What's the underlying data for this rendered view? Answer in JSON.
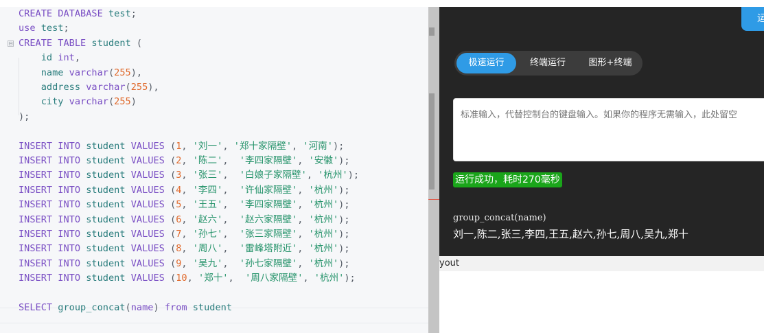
{
  "editor": {
    "fold_marker": "⊟",
    "lines": [
      [
        {
          "t": "CREATE DATABASE ",
          "c": "kw"
        },
        {
          "t": "test",
          "c": "id"
        },
        {
          "t": ";",
          "c": "pun"
        }
      ],
      [
        {
          "t": "use ",
          "c": "kw"
        },
        {
          "t": "test",
          "c": "id"
        },
        {
          "t": ";",
          "c": "pun"
        }
      ],
      [
        {
          "t": "CREATE TABLE ",
          "c": "kw"
        },
        {
          "t": "student ",
          "c": "id"
        },
        {
          "t": "(",
          "c": "pun"
        }
      ],
      [
        {
          "t": "    id ",
          "c": "id"
        },
        {
          "t": "int",
          "c": "kw"
        },
        {
          "t": ",",
          "c": "pun"
        }
      ],
      [
        {
          "t": "    name ",
          "c": "id"
        },
        {
          "t": "varchar",
          "c": "kw"
        },
        {
          "t": "(",
          "c": "pun"
        },
        {
          "t": "255",
          "c": "num"
        },
        {
          "t": "),",
          "c": "pun"
        }
      ],
      [
        {
          "t": "    address ",
          "c": "id"
        },
        {
          "t": "varchar",
          "c": "kw"
        },
        {
          "t": "(",
          "c": "pun"
        },
        {
          "t": "255",
          "c": "num"
        },
        {
          "t": "),",
          "c": "pun"
        }
      ],
      [
        {
          "t": "    city ",
          "c": "id"
        },
        {
          "t": "varchar",
          "c": "kw"
        },
        {
          "t": "(",
          "c": "pun"
        },
        {
          "t": "255",
          "c": "num"
        },
        {
          "t": ")",
          "c": "pun"
        }
      ],
      [
        {
          "t": ");",
          "c": "pun"
        }
      ],
      [],
      [
        {
          "t": "INSERT INTO ",
          "c": "kw"
        },
        {
          "t": "student ",
          "c": "id"
        },
        {
          "t": "VALUES ",
          "c": "kw"
        },
        {
          "t": "(",
          "c": "pun"
        },
        {
          "t": "1",
          "c": "num"
        },
        {
          "t": ", ",
          "c": "pun"
        },
        {
          "t": "'刘一'",
          "c": "str"
        },
        {
          "t": ", ",
          "c": "pun"
        },
        {
          "t": "'郑十家隔壁'",
          "c": "str"
        },
        {
          "t": ", ",
          "c": "pun"
        },
        {
          "t": "'河南'",
          "c": "str"
        },
        {
          "t": ");",
          "c": "pun"
        }
      ],
      [
        {
          "t": "INSERT INTO ",
          "c": "kw"
        },
        {
          "t": "student ",
          "c": "id"
        },
        {
          "t": "VALUES ",
          "c": "kw"
        },
        {
          "t": "(",
          "c": "pun"
        },
        {
          "t": "2",
          "c": "num"
        },
        {
          "t": ", ",
          "c": "pun"
        },
        {
          "t": "'陈二'",
          "c": "str"
        },
        {
          "t": ",  ",
          "c": "pun"
        },
        {
          "t": "'李四家隔壁'",
          "c": "str"
        },
        {
          "t": ", ",
          "c": "pun"
        },
        {
          "t": "'安徽'",
          "c": "str"
        },
        {
          "t": ");",
          "c": "pun"
        }
      ],
      [
        {
          "t": "INSERT INTO ",
          "c": "kw"
        },
        {
          "t": "student ",
          "c": "id"
        },
        {
          "t": "VALUES ",
          "c": "kw"
        },
        {
          "t": "(",
          "c": "pun"
        },
        {
          "t": "3",
          "c": "num"
        },
        {
          "t": ", ",
          "c": "pun"
        },
        {
          "t": "'张三'",
          "c": "str"
        },
        {
          "t": ",  ",
          "c": "pun"
        },
        {
          "t": "'白娘子家隔壁'",
          "c": "str"
        },
        {
          "t": ", ",
          "c": "pun"
        },
        {
          "t": "'杭州'",
          "c": "str"
        },
        {
          "t": ");",
          "c": "pun"
        }
      ],
      [
        {
          "t": "INSERT INTO ",
          "c": "kw"
        },
        {
          "t": "student ",
          "c": "id"
        },
        {
          "t": "VALUES ",
          "c": "kw"
        },
        {
          "t": "(",
          "c": "pun"
        },
        {
          "t": "4",
          "c": "num"
        },
        {
          "t": ", ",
          "c": "pun"
        },
        {
          "t": "'李四'",
          "c": "str"
        },
        {
          "t": ",  ",
          "c": "pun"
        },
        {
          "t": "'许仙家隔壁'",
          "c": "str"
        },
        {
          "t": ", ",
          "c": "pun"
        },
        {
          "t": "'杭州'",
          "c": "str"
        },
        {
          "t": ");",
          "c": "pun"
        }
      ],
      [
        {
          "t": "INSERT INTO ",
          "c": "kw"
        },
        {
          "t": "student ",
          "c": "id"
        },
        {
          "t": "VALUES ",
          "c": "kw"
        },
        {
          "t": "(",
          "c": "pun"
        },
        {
          "t": "5",
          "c": "num"
        },
        {
          "t": ", ",
          "c": "pun"
        },
        {
          "t": "'王五'",
          "c": "str"
        },
        {
          "t": ",  ",
          "c": "pun"
        },
        {
          "t": "'李四家隔壁'",
          "c": "str"
        },
        {
          "t": ", ",
          "c": "pun"
        },
        {
          "t": "'杭州'",
          "c": "str"
        },
        {
          "t": ");",
          "c": "pun"
        }
      ],
      [
        {
          "t": "INSERT INTO ",
          "c": "kw"
        },
        {
          "t": "student ",
          "c": "id"
        },
        {
          "t": "VALUES ",
          "c": "kw"
        },
        {
          "t": "(",
          "c": "pun"
        },
        {
          "t": "6",
          "c": "num"
        },
        {
          "t": ", ",
          "c": "pun"
        },
        {
          "t": "'赵六'",
          "c": "str"
        },
        {
          "t": ",  ",
          "c": "pun"
        },
        {
          "t": "'赵六家隔壁'",
          "c": "str"
        },
        {
          "t": ", ",
          "c": "pun"
        },
        {
          "t": "'杭州'",
          "c": "str"
        },
        {
          "t": ");",
          "c": "pun"
        }
      ],
      [
        {
          "t": "INSERT INTO ",
          "c": "kw"
        },
        {
          "t": "student ",
          "c": "id"
        },
        {
          "t": "VALUES ",
          "c": "kw"
        },
        {
          "t": "(",
          "c": "pun"
        },
        {
          "t": "7",
          "c": "num"
        },
        {
          "t": ", ",
          "c": "pun"
        },
        {
          "t": "'孙七'",
          "c": "str"
        },
        {
          "t": ",  ",
          "c": "pun"
        },
        {
          "t": "'张三家隔壁'",
          "c": "str"
        },
        {
          "t": ", ",
          "c": "pun"
        },
        {
          "t": "'杭州'",
          "c": "str"
        },
        {
          "t": ");",
          "c": "pun"
        }
      ],
      [
        {
          "t": "INSERT INTO ",
          "c": "kw"
        },
        {
          "t": "student ",
          "c": "id"
        },
        {
          "t": "VALUES ",
          "c": "kw"
        },
        {
          "t": "(",
          "c": "pun"
        },
        {
          "t": "8",
          "c": "num"
        },
        {
          "t": ", ",
          "c": "pun"
        },
        {
          "t": "'周八'",
          "c": "str"
        },
        {
          "t": ",  ",
          "c": "pun"
        },
        {
          "t": "'雷峰塔附近'",
          "c": "str"
        },
        {
          "t": ", ",
          "c": "pun"
        },
        {
          "t": "'杭州'",
          "c": "str"
        },
        {
          "t": ");",
          "c": "pun"
        }
      ],
      [
        {
          "t": "INSERT INTO ",
          "c": "kw"
        },
        {
          "t": "student ",
          "c": "id"
        },
        {
          "t": "VALUES ",
          "c": "kw"
        },
        {
          "t": "(",
          "c": "pun"
        },
        {
          "t": "9",
          "c": "num"
        },
        {
          "t": ", ",
          "c": "pun"
        },
        {
          "t": "'吴九'",
          "c": "str"
        },
        {
          "t": ",  ",
          "c": "pun"
        },
        {
          "t": "'孙七家隔壁'",
          "c": "str"
        },
        {
          "t": ", ",
          "c": "pun"
        },
        {
          "t": "'杭州'",
          "c": "str"
        },
        {
          "t": ");",
          "c": "pun"
        }
      ],
      [
        {
          "t": "INSERT INTO ",
          "c": "kw"
        },
        {
          "t": "student ",
          "c": "id"
        },
        {
          "t": "VALUES ",
          "c": "kw"
        },
        {
          "t": "(",
          "c": "pun"
        },
        {
          "t": "10",
          "c": "num"
        },
        {
          "t": ", ",
          "c": "pun"
        },
        {
          "t": "'郑十'",
          "c": "str"
        },
        {
          "t": ",  ",
          "c": "pun"
        },
        {
          "t": "'周八家隔壁'",
          "c": "str"
        },
        {
          "t": ", ",
          "c": "pun"
        },
        {
          "t": "'杭州'",
          "c": "str"
        },
        {
          "t": ");",
          "c": "pun"
        }
      ],
      [],
      [
        {
          "t": "SELECT ",
          "c": "kw"
        },
        {
          "t": "group_concat",
          "c": "id"
        },
        {
          "t": "(",
          "c": "pun"
        },
        {
          "t": "name",
          "c": "kw"
        },
        {
          "t": ") ",
          "c": "pun"
        },
        {
          "t": "from ",
          "c": "kw"
        },
        {
          "t": "student",
          "c": "id"
        }
      ]
    ]
  },
  "run_panel": {
    "top_button_label": "运",
    "tabs": [
      {
        "label": "极速运行",
        "active": true
      },
      {
        "label": "终端运行",
        "active": false
      },
      {
        "label": "图形+终端",
        "active": false
      }
    ],
    "stdin_placeholder": "标准输入，代替控制台的键盘输入。如果你的程序无需输入，此处留空",
    "status": "运行成功，耗时270毫秒",
    "output_header": "group_concat(name)",
    "output_value": "刘一,陈二,张三,李四,王五,赵六,孙七,周八,吴九,郑十"
  },
  "layout_strip_label": "yout",
  "colors": {
    "accent": "#2f9be6",
    "success": "#1aa51a",
    "keyword": "#7a4fc4",
    "number": "#e0692b",
    "string": "#25936a",
    "identifier": "#2a7d7d"
  }
}
